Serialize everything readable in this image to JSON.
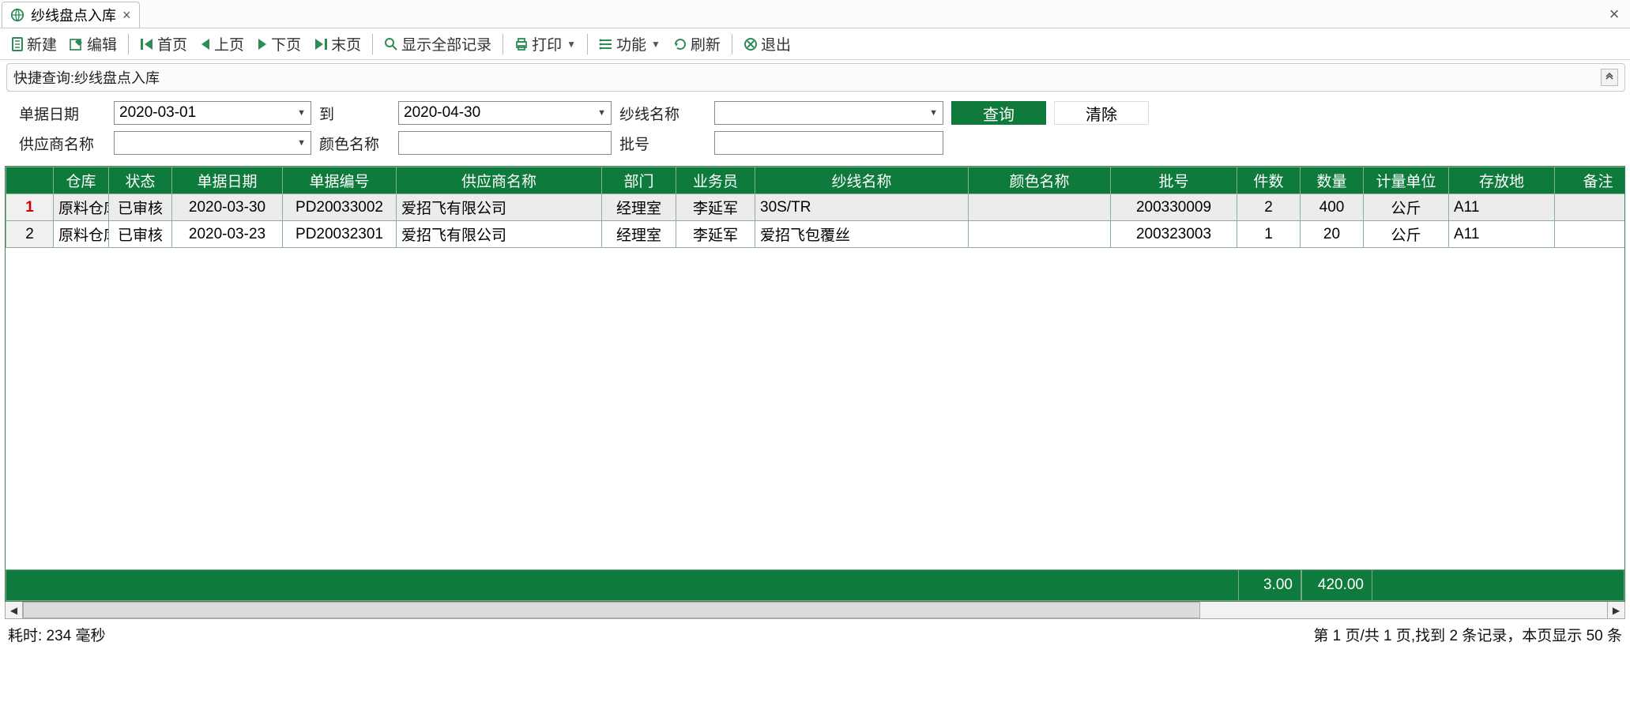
{
  "tab": {
    "title": "纱线盘点入库"
  },
  "toolbar": {
    "new": "新建",
    "edit": "编辑",
    "first": "首页",
    "prev": "上页",
    "next": "下页",
    "last": "末页",
    "showall": "显示全部记录",
    "print": "打印",
    "func": "功能",
    "refresh": "刷新",
    "exit": "退出"
  },
  "quick": {
    "title": "快捷查询:纱线盘点入库"
  },
  "search": {
    "date_label": "单据日期",
    "date_from": "2020-03-01",
    "to": "到",
    "date_to": "2020-04-30",
    "yarn_label": "纱线名称",
    "btn_search": "查询",
    "btn_clear": "清除",
    "supplier_label": "供应商名称",
    "color_label": "颜色名称",
    "lot_label": "批号"
  },
  "columns": [
    "",
    "仓库",
    "状态",
    "单据日期",
    "单据编号",
    "供应商名称",
    "部门",
    "业务员",
    "纱线名称",
    "颜色名称",
    "批号",
    "件数",
    "数量",
    "计量单位",
    "存放地",
    "备注"
  ],
  "rows": [
    {
      "n": "1",
      "wh": "原料仓库",
      "st": "已审核",
      "dt": "2020-03-30",
      "no": "PD20033002",
      "sup": "爱招飞有限公司",
      "dep": "经理室",
      "agent": "李延军",
      "yarn": "30S/TR",
      "color": "",
      "lot": "200330009",
      "qty": "2",
      "amt": "400",
      "unit": "公斤",
      "loc": "A11",
      "rmk": ""
    },
    {
      "n": "2",
      "wh": "原料仓库",
      "st": "已审核",
      "dt": "2020-03-23",
      "no": "PD20032301",
      "sup": "爱招飞有限公司",
      "dep": "经理室",
      "agent": "李延军",
      "yarn": "爱招飞包覆丝",
      "color": "",
      "lot": "200323003",
      "qty": "1",
      "amt": "20",
      "unit": "公斤",
      "loc": "A11",
      "rmk": ""
    }
  ],
  "summary": {
    "qty": "3.00",
    "amt": "420.00"
  },
  "footer": {
    "left": "耗时: 234 毫秒",
    "right": "第 1 页/共 1 页,找到 2 条记录，本页显示 50 条"
  }
}
